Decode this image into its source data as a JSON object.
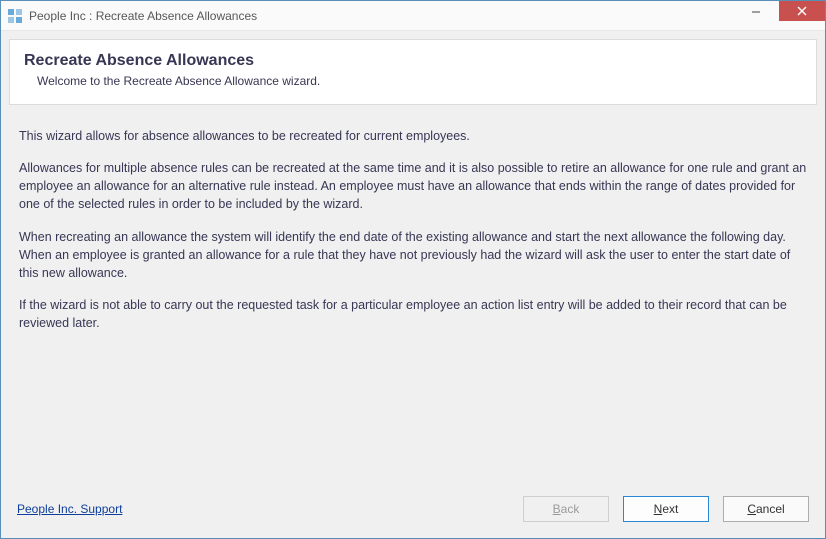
{
  "window": {
    "title": "People Inc : Recreate Absence Allowances"
  },
  "header": {
    "heading": "Recreate Absence Allowances",
    "subtitle": "Welcome to the Recreate Absence Allowance wizard."
  },
  "body": {
    "p1": "This wizard allows for absence allowances to be recreated for current employees.",
    "p2": "Allowances for multiple absence rules can be recreated at the same time and it is also possible to retire an allowance for one rule and grant an employee an allowance for an alternative rule instead. An employee must have an allowance that ends within the range of dates provided for one of the selected rules in order to be included by the wizard.",
    "p3": "When recreating an allowance the system will identify the end date of the existing allowance and start the next allowance the following day. When an employee is granted an allowance for a rule that they have not previously had the wizard will ask the user to enter the start date of this new allowance.",
    "p4": "If the wizard is not able to carry out the requested task for a particular employee an action list entry will be added to their record that can be reviewed later."
  },
  "footer": {
    "support_link": "People Inc. Support",
    "back_pre": "",
    "back_mn": "B",
    "back_post": "ack",
    "next_pre": "",
    "next_mn": "N",
    "next_post": "ext",
    "cancel_pre": "",
    "cancel_mn": "C",
    "cancel_post": "ancel"
  }
}
